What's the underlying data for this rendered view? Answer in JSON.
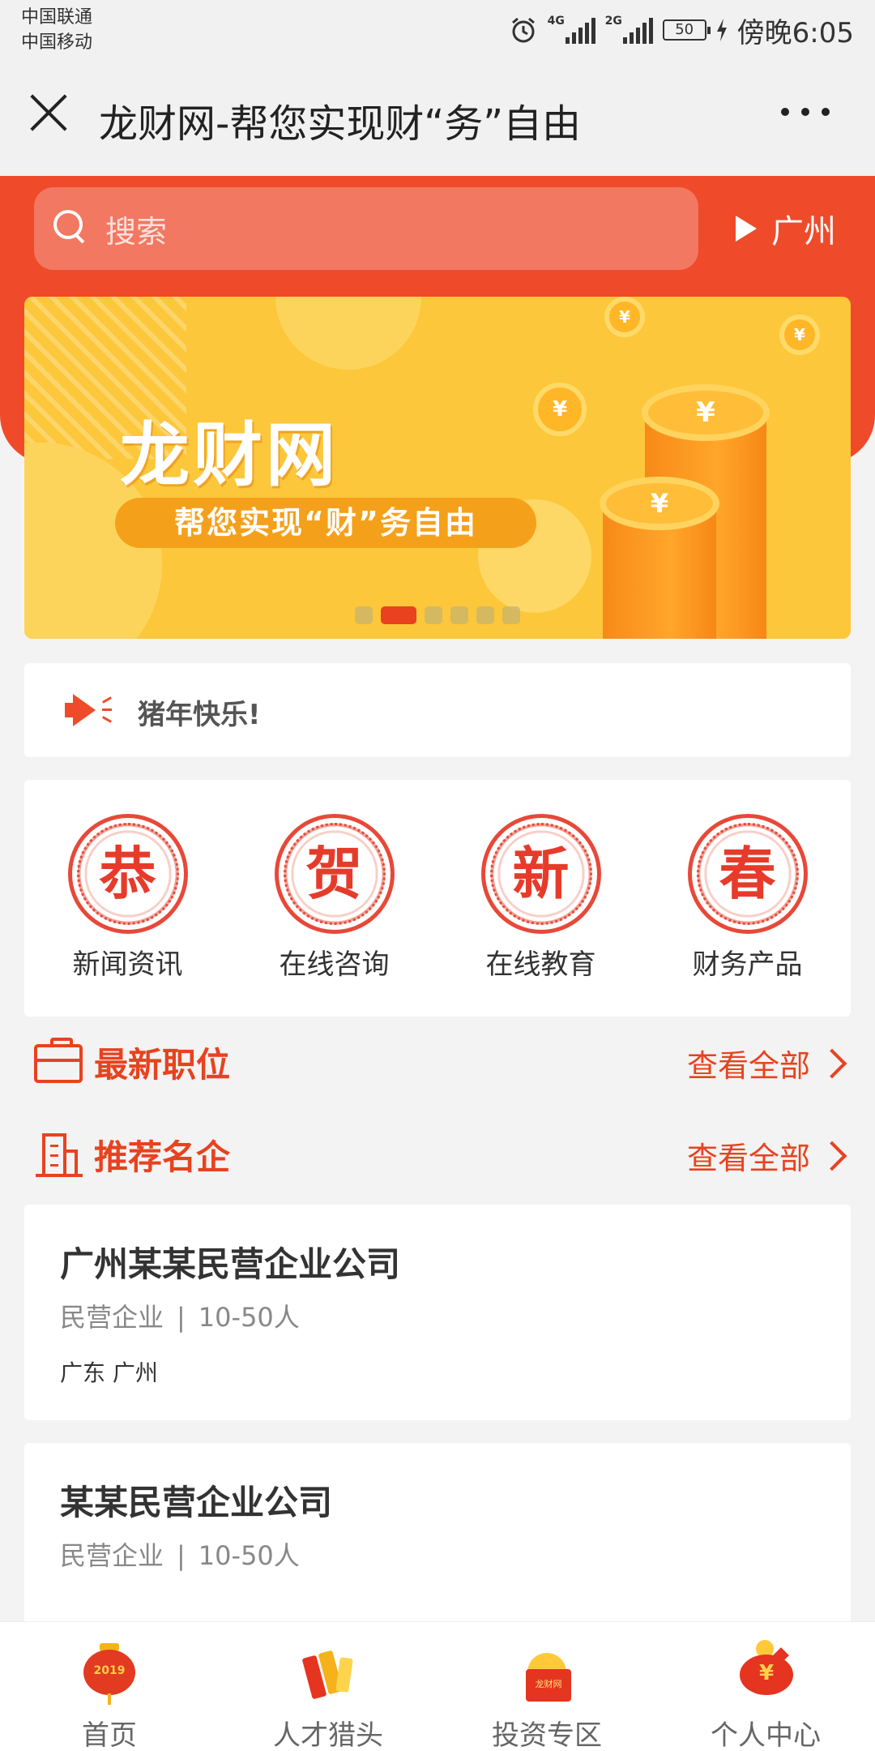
{
  "status_bar": {
    "carrier1": "中国联通",
    "carrier2": "中国移动",
    "net1": "4G",
    "net2": "2G",
    "battery": "50",
    "time": "傍晚6:05"
  },
  "titlebar": {
    "title": "龙财网-帮您实现财“务”自由"
  },
  "search": {
    "placeholder": "搜索",
    "city": "广州"
  },
  "banner": {
    "brand": "龙财网",
    "slogan": "帮您实现“财”务自由",
    "slide_count": 6,
    "active_slide": 2
  },
  "notice": {
    "text": "猪年快乐!"
  },
  "grid": {
    "items": [
      {
        "char": "恭",
        "label": "新闻资讯"
      },
      {
        "char": "贺",
        "label": "在线咨询"
      },
      {
        "char": "新",
        "label": "在线教育"
      },
      {
        "char": "春",
        "label": "财务产品"
      }
    ]
  },
  "sections": {
    "jobs": {
      "title": "最新职位",
      "more": "查看全部"
    },
    "companies": {
      "title": "推荐名企",
      "more": "查看全部"
    }
  },
  "companies": [
    {
      "name": "广州某某民营企业公司",
      "type": "民营企业",
      "sep": "|",
      "size": "10-50人",
      "location": "广东 广州"
    },
    {
      "name": "某某民营企业公司",
      "type": "民营企业",
      "sep": "|",
      "size": "10-50人"
    }
  ],
  "tabbar": {
    "tabs": [
      {
        "label": "首页",
        "icon": "lantern-icon",
        "badge": "2019"
      },
      {
        "label": "人才猎头",
        "icon": "firecracker-icon"
      },
      {
        "label": "投资专区",
        "icon": "gold-gift-icon",
        "badge": "龙财网"
      },
      {
        "label": "个人中心",
        "icon": "piggy-bank-icon",
        "badge": "¥"
      }
    ]
  },
  "colors": {
    "brand_red": "#ef4b2a",
    "accent_orange": "#e8421f",
    "banner_yellow": "#fcc73a"
  }
}
